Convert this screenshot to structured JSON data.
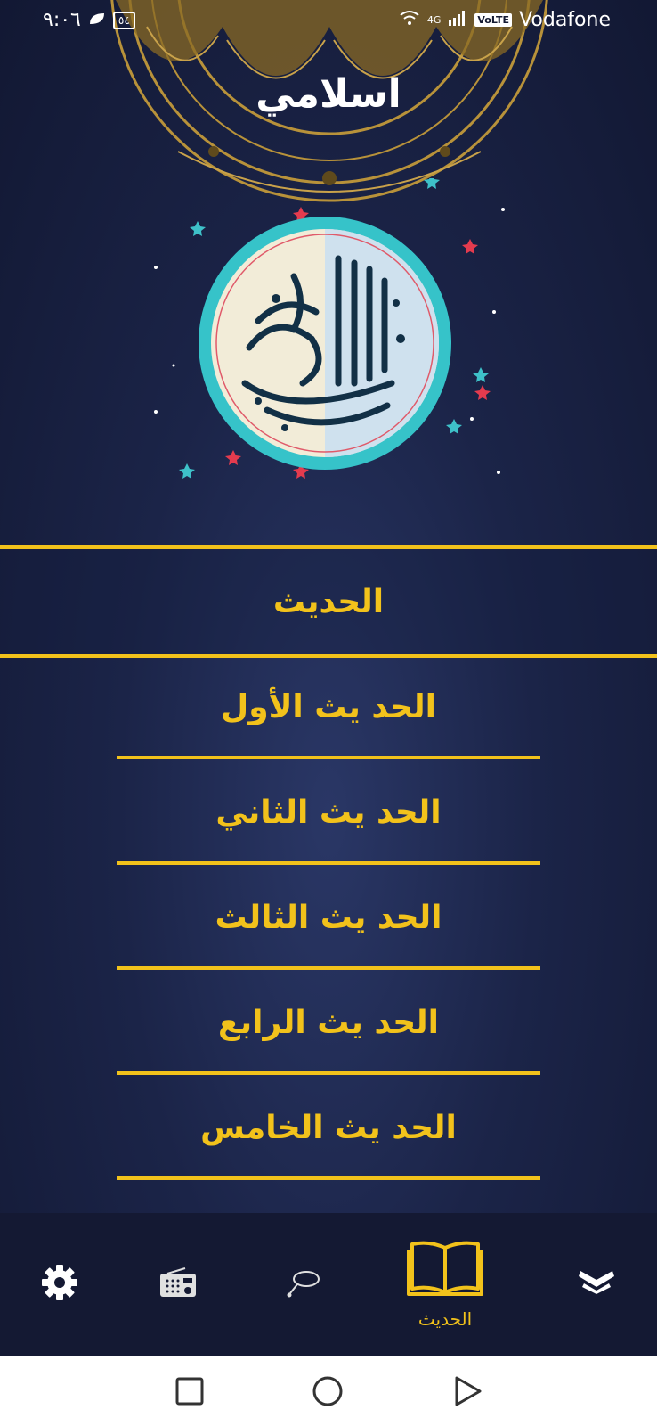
{
  "status_bar": {
    "time": "٩:٠٦",
    "battery": "٥٤",
    "network": "4G",
    "volte": "VoLTE",
    "carrier": "Vodafone"
  },
  "app": {
    "title": "اسلامي"
  },
  "section": {
    "title": "الحديث"
  },
  "hadith_list": [
    {
      "label": "الحد يث الأول"
    },
    {
      "label": "الحد يث الثاني"
    },
    {
      "label": "الحد يث الثالث"
    },
    {
      "label": "الحد يث الرابع"
    },
    {
      "label": "الحد يث الخامس"
    }
  ],
  "bottom_nav": {
    "items": [
      {
        "icon": "gear-icon"
      },
      {
        "icon": "radio-icon"
      },
      {
        "icon": "sebha-icon"
      },
      {
        "icon": "book-icon",
        "label": "الحديث",
        "active": true
      },
      {
        "icon": "quran-icon"
      }
    ]
  },
  "colors": {
    "accent": "#f2c21b",
    "background": "#1b2448",
    "nav_background": "#141933"
  }
}
